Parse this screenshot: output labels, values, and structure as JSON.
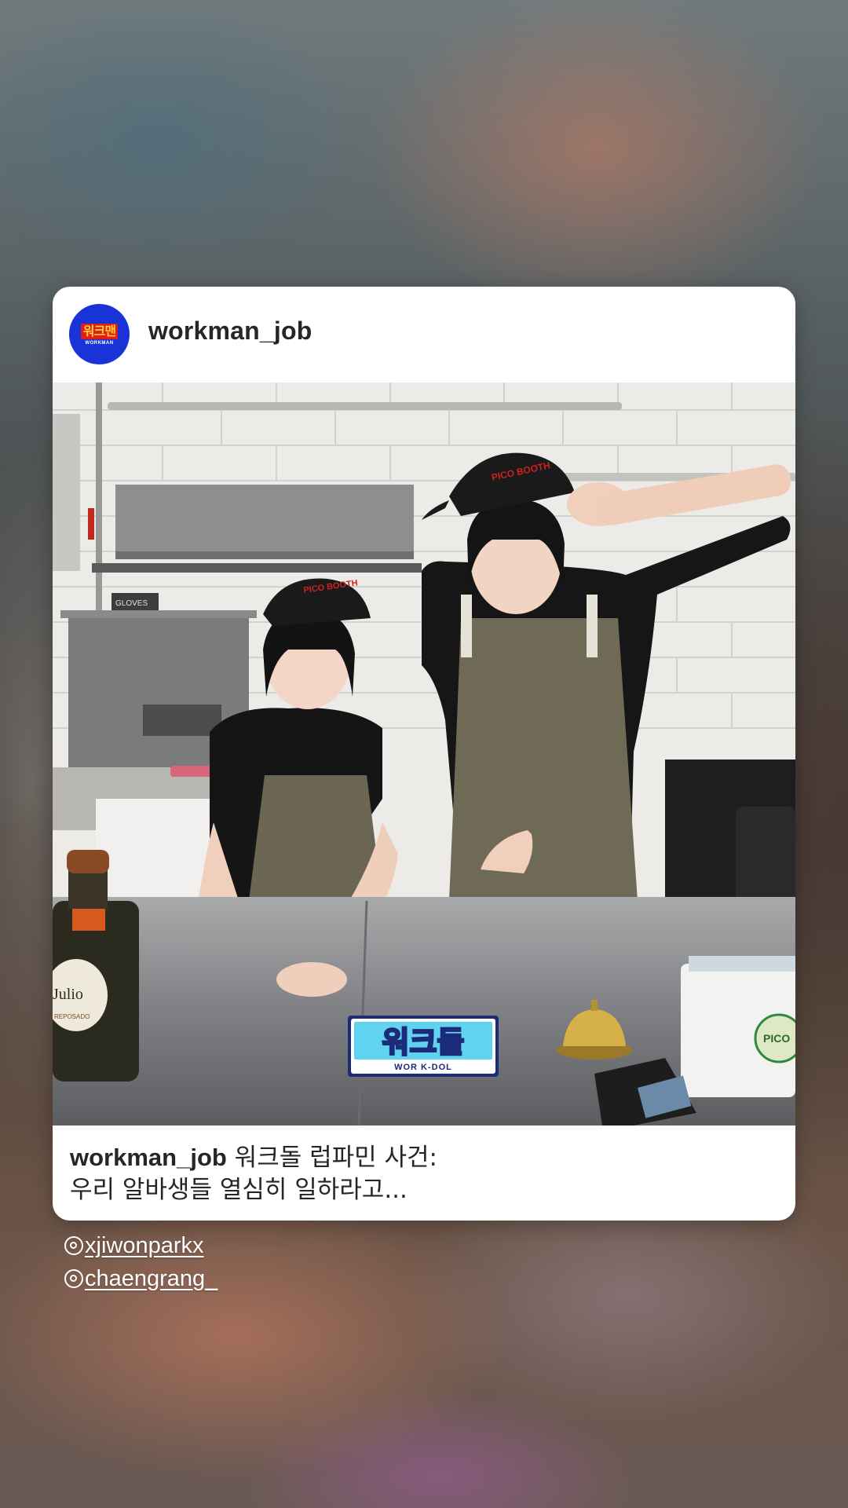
{
  "post": {
    "account": {
      "username": "workman_job",
      "avatar_text": "워크맨",
      "avatar_subtext": "WORKMAN"
    },
    "photo": {
      "sticker_main": "워크돌",
      "sticker_sub": "WOR K-DOL",
      "apron_text": "PICO BOOTH",
      "bottle_label": "Julio",
      "bottle_sub": "REPOSADO",
      "shelf_label": "GLOVES",
      "pos_label": "PICO"
    },
    "caption": {
      "username": "workman_job",
      "line1": " 워크돌 럽파민 사건:",
      "line2": "우리 알바생들 열심히 일하라고..."
    }
  },
  "mentions": [
    "xjiwonparkx",
    "chaengrang_"
  ],
  "colors": {
    "avatar_bg": "#1a33d6",
    "card_bg": "#ffffff",
    "text_primary": "#262626"
  }
}
